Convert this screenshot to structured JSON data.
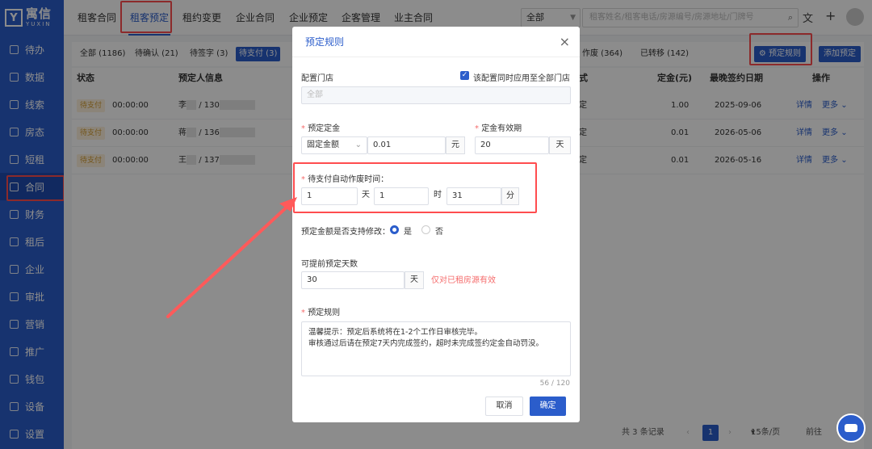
{
  "logo": {
    "name": "寓信",
    "sub": "YUXIN"
  },
  "sidebar": {
    "items": [
      {
        "label": "待办"
      },
      {
        "label": "数据"
      },
      {
        "label": "线索"
      },
      {
        "label": "房态"
      },
      {
        "label": "短租"
      },
      {
        "label": "合同"
      },
      {
        "label": "财务"
      },
      {
        "label": "租后"
      },
      {
        "label": "企业"
      },
      {
        "label": "审批"
      },
      {
        "label": "营销"
      },
      {
        "label": "推广"
      },
      {
        "label": "钱包"
      },
      {
        "label": "设备"
      },
      {
        "label": "设置"
      }
    ]
  },
  "topnav": {
    "tabs": [
      {
        "label": "租客合同"
      },
      {
        "label": "租客预定"
      },
      {
        "label": "租约变更"
      },
      {
        "label": "企业合同"
      },
      {
        "label": "企业预定"
      },
      {
        "label": "企客管理"
      },
      {
        "label": "业主合同"
      }
    ],
    "scope_select": "全部",
    "search_placeholder": "租客姓名/租客电话/房源编号/房源地址/门牌号"
  },
  "filters": {
    "chips": [
      "全部 (1186)",
      "待确认 (21)",
      "待签字 (3)",
      "待支付 (3)",
      "作废 (364)",
      "已转移 (142)"
    ],
    "rules_button": "预定规则",
    "add_button": "添加预定"
  },
  "table": {
    "headers": {
      "status": "状态",
      "person": "预定人信息",
      "type": "式",
      "deposit": "定金(元)",
      "last_date": "最晚签约日期",
      "ops": "操作"
    },
    "rows": [
      {
        "status": "待支付",
        "time": "00:00:00",
        "name": "李",
        "phone": "/ 130",
        "type": "定",
        "deposit": "1.00",
        "date": "2025-09-06"
      },
      {
        "status": "待支付",
        "time": "00:00:00",
        "name": "蒋",
        "phone": "/ 136",
        "type": "定",
        "deposit": "0.01",
        "date": "2026-05-06"
      },
      {
        "status": "待支付",
        "time": "00:00:00",
        "name": "王",
        "phone": "/ 137",
        "type": "定",
        "deposit": "0.01",
        "date": "2026-05-16"
      }
    ],
    "detail_link": "详情",
    "more_link": "更多"
  },
  "pager": {
    "total": "共 3 条记录",
    "page": "1",
    "per_page": "15条/页",
    "goto": "前往"
  },
  "dialog": {
    "title": "预定规则",
    "store_label": "配置门店",
    "apply_all_label": "该配置同时应用至全部门店",
    "store_value": "全部",
    "deposit_label": "预定定金",
    "deposit_type": "固定金额",
    "deposit_amount": "0.01",
    "deposit_unit": "元",
    "validity_label": "定金有效期",
    "validity_value": "20",
    "validity_unit": "天",
    "auto_void_label": "待支付自动作废时间：",
    "auto_void_days": "1",
    "unit_day": "天",
    "auto_void_hours": "1",
    "unit_hour": "时",
    "auto_void_minutes": "31",
    "unit_minute": "分",
    "modify_label": "预定金额是否支持修改：",
    "yes": "是",
    "no": "否",
    "advance_label": "可提前预定天数",
    "advance_value": "30",
    "advance_unit": "天",
    "advance_note": "仅对已租房源有效",
    "rules_label": "预定规则",
    "rules_text_1": "温馨提示：预定后系统将在1-2个工作日审核完毕。",
    "rules_text_2": "审核通过后请在预定7天内完成签约，超时未完成签约定金自动罚没。",
    "counter": "56 / 120",
    "cancel": "取消",
    "confirm": "确定"
  }
}
